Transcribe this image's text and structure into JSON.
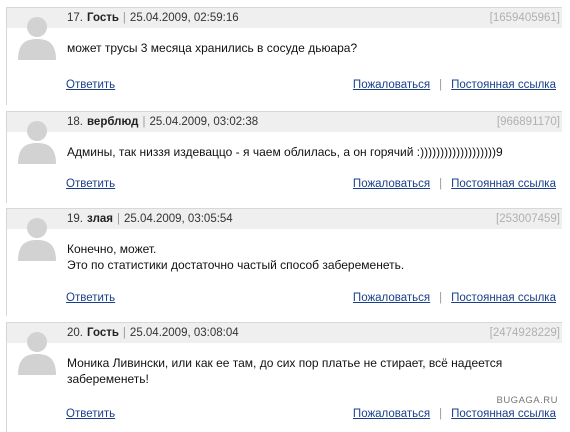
{
  "comments": [
    {
      "number": "17.",
      "author": "Гость",
      "timestamp": "25.04.2009, 02:59:16",
      "id": "[1659405961]",
      "lines": [
        "может трусы 3 месяца хранились в сосуде дьюара?"
      ],
      "reply_label": "Ответить",
      "report_label": "Пожаловаться",
      "permalink_label": "Постоянная ссылка"
    },
    {
      "number": "18.",
      "author": "верблюд",
      "timestamp": "25.04.2009, 03:02:38",
      "id": "[966891170]",
      "lines": [
        "Админы, так низзя издеваццо - я чаем облилась, а он горячий :)))))))))))))))))))9"
      ],
      "reply_label": "Ответить",
      "report_label": "Пожаловаться",
      "permalink_label": "Постоянная ссылка"
    },
    {
      "number": "19.",
      "author": "злая",
      "timestamp": "25.04.2009, 03:05:54",
      "id": "[253007459]",
      "lines": [
        "Конечно, может.",
        "Это по статистики достаточно частый способ забеременеть."
      ],
      "reply_label": "Ответить",
      "report_label": "Пожаловаться",
      "permalink_label": "Постоянная ссылка"
    },
    {
      "number": "20.",
      "author": "Гость",
      "timestamp": "25.04.2009, 03:08:04",
      "id": "[2474928229]",
      "lines": [
        "Моника Ливински, или как ее там, до сих пор платье не стирает, всё надеется",
        "забеременеть!"
      ],
      "reply_label": "Ответить",
      "report_label": "Пожаловаться",
      "permalink_label": "Постоянная ссылка"
    }
  ],
  "meta_separator": "|",
  "link_separator": "|",
  "avatar_icon": "user-silhouette-icon",
  "watermark": "BUGAGA.RU"
}
